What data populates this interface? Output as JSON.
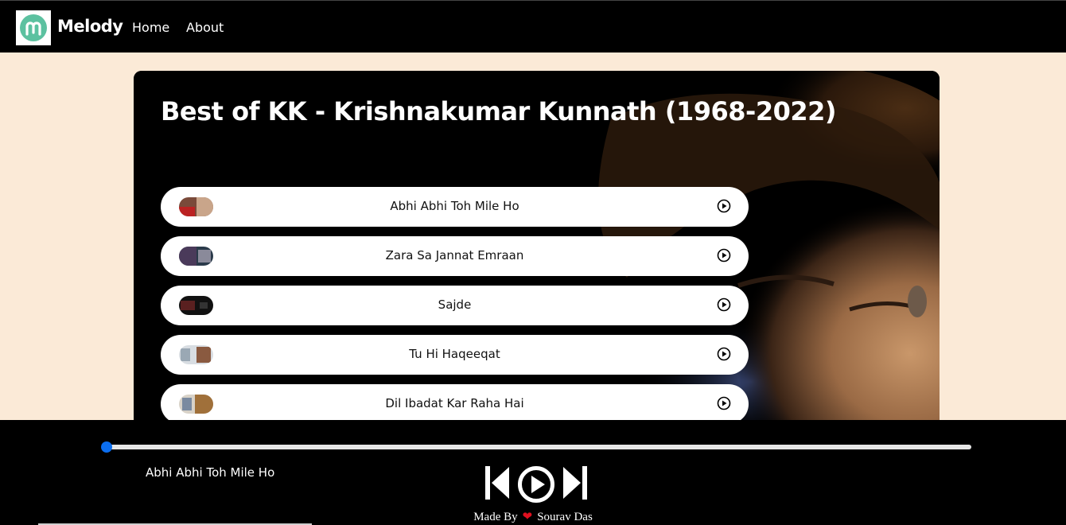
{
  "navbar": {
    "brand": "Melody",
    "links": [
      "Home",
      "About"
    ],
    "logo_color": "#5cc1a0"
  },
  "playlist": {
    "title": "Best of KK - Krishnakumar Kunnath (1968-2022)",
    "songs": [
      {
        "title": "Abhi Abhi Toh Mile Ho"
      },
      {
        "title": "Zara Sa Jannat Emraan"
      },
      {
        "title": "Sajde"
      },
      {
        "title": "Tu Hi Haqeeqat"
      },
      {
        "title": "Dil Ibadat Kar Raha Hai"
      }
    ]
  },
  "player": {
    "now_playing": "Abhi Abhi Toh Mile Ho",
    "progress_fraction": 0.0,
    "accent_color": "#0b6ef0",
    "controls": [
      "previous-icon",
      "play-icon",
      "next-icon"
    ]
  },
  "footer": {
    "made_by": "Made By",
    "heart": "❤",
    "author": "Sourav Das"
  }
}
